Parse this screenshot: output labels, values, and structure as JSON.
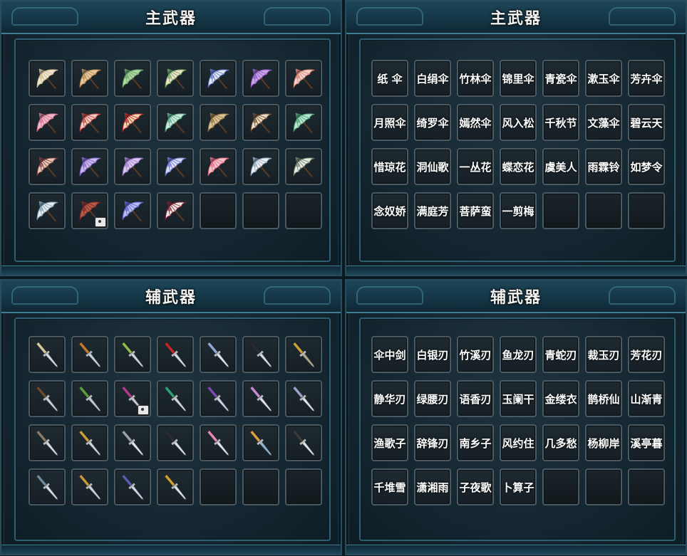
{
  "panels": {
    "main_icons": {
      "title": "主武器"
    },
    "main_names": {
      "title": "主武器"
    },
    "sub_icons": {
      "title": "辅武器"
    },
    "sub_names": {
      "title": "辅武器"
    }
  },
  "main_weapons": [
    "纸 伞",
    "白绢伞",
    "竹林伞",
    "锦里伞",
    "青瓷伞",
    "漱玉伞",
    "芳卉伞",
    "月照伞",
    "绮罗伞",
    "嫣然伞",
    "风入松",
    "千秋节",
    "文藻伞",
    "碧云天",
    "惜琼花",
    "洞仙歌",
    "一丛花",
    "蝶恋花",
    "虞美人",
    "雨霖铃",
    "如梦令",
    "念奴娇",
    "满庭芳",
    "菩萨蛮",
    "一剪梅"
  ],
  "sub_weapons": [
    "伞中剑",
    "白银刃",
    "竹溪刃",
    "鱼龙刃",
    "青蛇刃",
    "裁玉刃",
    "芳花刃",
    "静华刃",
    "绿腰刃",
    "语香刃",
    "玉阑干",
    "金缕衣",
    "鹊桥仙",
    "山渐青",
    "渔歌子",
    "辞锋刃",
    "南乡子",
    "风约住",
    "几多愁",
    "杨柳岸",
    "溪亭暮",
    "千堆雪",
    "潇湘雨",
    "子夜歌",
    "卜算子"
  ],
  "umbrella_icons": [
    {
      "canopy": "#efe6cf",
      "accent": "#c9b98f"
    },
    {
      "canopy": "#e8c79a",
      "accent": "#b08a55"
    },
    {
      "canopy": "#a9d8a0",
      "accent": "#6a9e66"
    },
    {
      "canopy": "#f1e4cc",
      "accent": "#6aa05a"
    },
    {
      "canopy": "#e2e6f4",
      "accent": "#5b6fc0"
    },
    {
      "canopy": "#c9a2e6",
      "accent": "#8c58bd"
    },
    {
      "canopy": "#f4d1c9",
      "accent": "#d27c6e"
    },
    {
      "canopy": "#f2b6c8",
      "accent": "#c96d8c"
    },
    {
      "canopy": "#f4c9c0",
      "accent": "#b5423a"
    },
    {
      "canopy": "#f0d7b0",
      "accent": "#b3262a"
    },
    {
      "canopy": "#cde9dc",
      "accent": "#5aa88a"
    },
    {
      "canopy": "#d9c39a",
      "accent": "#8a6b3b"
    },
    {
      "canopy": "#e9dcc4",
      "accent": "#6b4a2a"
    },
    {
      "canopy": "#b8e6cc",
      "accent": "#4a9a72"
    },
    {
      "canopy": "#e6c7b6",
      "accent": "#7a3a3a"
    },
    {
      "canopy": "#cbb8ec",
      "accent": "#7e63c4"
    },
    {
      "canopy": "#dcc8ee",
      "accent": "#9a7ac8"
    },
    {
      "canopy": "#d8dcf4",
      "accent": "#6a72c8"
    },
    {
      "canopy": "#f4c4cc",
      "accent": "#e2667e"
    },
    {
      "canopy": "#eef0f4",
      "accent": "#8aa0b6"
    },
    {
      "canopy": "#e6ebe2",
      "accent": "#6b7a66"
    },
    {
      "canopy": "#e4ecf2",
      "accent": "#7b98ac"
    },
    {
      "canopy": "#b8584a",
      "accent": "#7a2a22"
    },
    {
      "canopy": "#b8baf0",
      "accent": "#5c5ec4"
    },
    {
      "canopy": "#f0e6e6",
      "accent": "#7a1f2e"
    }
  ],
  "blade_icons": [
    {
      "hilt": "#d8c8a0",
      "blade": "#d6dde2"
    },
    {
      "hilt": "#c27a2a",
      "blade": "#c9d2d8"
    },
    {
      "hilt": "#8cbf4a",
      "blade": "#cfd8dc"
    },
    {
      "hilt": "#c4262a",
      "blade": "#d6dde2"
    },
    {
      "hilt": "#8fa7d6",
      "blade": "#e4eaee"
    },
    {
      "hilt": "#2a2a30",
      "blade": "#d8dee2"
    },
    {
      "hilt": "#c9a23a",
      "blade": "#b8aa80"
    },
    {
      "hilt": "#6a4a2a",
      "blade": "#c9d2d8"
    },
    {
      "hilt": "#5aa03a",
      "blade": "#c2ccd0"
    },
    {
      "hilt": "#b03a8c",
      "blade": "#d0c4d8"
    },
    {
      "hilt": "#2aa07a",
      "blade": "#cfd8dc"
    },
    {
      "hilt": "#7a4ab8",
      "blade": "#d8d0e8"
    },
    {
      "hilt": "#c48ad0",
      "blade": "#e6e0f0"
    },
    {
      "hilt": "#9aa0c8",
      "blade": "#e0e4f0"
    },
    {
      "hilt": "#8a7a6a",
      "blade": "#d8dee2"
    },
    {
      "hilt": "#c9a03a",
      "blade": "#cfd6da"
    },
    {
      "hilt": "#9aa2aa",
      "blade": "#e2e8ec"
    },
    {
      "hilt": "#2a2a3a",
      "blade": "#dce2e8"
    },
    {
      "hilt": "#e28ab0",
      "blade": "#e4e4ec"
    },
    {
      "hilt": "#d8a040",
      "blade": "#8ab6d8"
    },
    {
      "hilt": "#3a3a3a",
      "blade": "#dfe4e8"
    },
    {
      "hilt": "#6a8aa0",
      "blade": "#d8e0e6"
    },
    {
      "hilt": "#c99a3a",
      "blade": "#cfd6da"
    },
    {
      "hilt": "#5a5ab0",
      "blade": "#d6d8ee"
    },
    {
      "hilt": "#d0a030",
      "blade": "#e0e4e8"
    }
  ],
  "locked_main_index": 22,
  "locked_sub_index": 9
}
